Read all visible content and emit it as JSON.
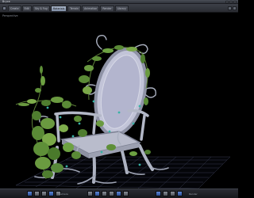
{
  "window": {
    "title": "Bryce"
  },
  "tabs": [
    {
      "label": "Create",
      "active": false
    },
    {
      "label": "Edit",
      "active": false
    },
    {
      "label": "Sky & Fog",
      "active": false
    },
    {
      "label": "Materials",
      "active": true
    },
    {
      "label": "Terrain",
      "active": false
    },
    {
      "label": "Animation",
      "active": false
    },
    {
      "label": "Render",
      "active": false
    },
    {
      "label": "Library",
      "active": false
    }
  ],
  "viewport": {
    "label": "Perspective",
    "scene": "vine-covered throne on ground grid"
  },
  "bottom_toolbar": {
    "left_label": "Camera",
    "right_label": "Render"
  },
  "colors": {
    "viewport_bg": "#000000",
    "active_tab": "#a9b6c9",
    "toolbar_blue": "#3b62b3",
    "chair": "#b7bccc",
    "vines": "#5b8a3a"
  }
}
